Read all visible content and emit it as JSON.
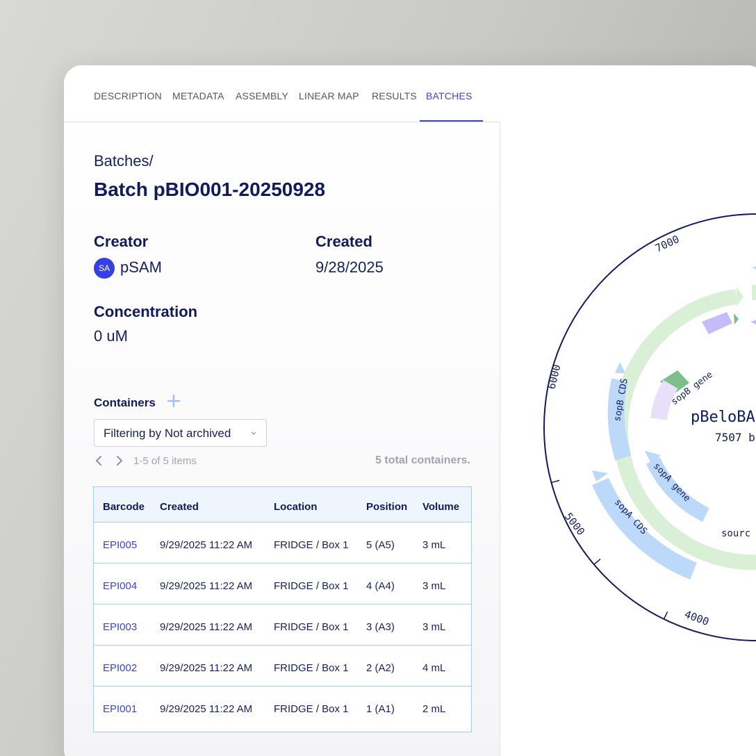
{
  "tabs": [
    {
      "label": "DESCRIPTION",
      "active": false
    },
    {
      "label": "METADATA",
      "active": false
    },
    {
      "label": "ASSEMBLY",
      "active": false
    },
    {
      "label": "LINEAR MAP",
      "active": false
    },
    {
      "label": "RESULTS",
      "active": false
    },
    {
      "label": "BATCHES",
      "active": true
    }
  ],
  "breadcrumb": "Batches/",
  "title": "Batch pBIO001-20250928",
  "creator": {
    "label": "Creator",
    "avatar_initials": "SA",
    "name": "pSAM"
  },
  "created": {
    "label": "Created",
    "value": "9/28/2025"
  },
  "concentration": {
    "label": "Concentration",
    "value": "0 uM"
  },
  "containers": {
    "label": "Containers",
    "filter": "Filtering by Not archived",
    "pager": "1-5 of 5 items",
    "total": "5 total containers.",
    "columns": [
      "Barcode",
      "Created",
      "Location",
      "Position",
      "Volume"
    ],
    "rows": [
      {
        "barcode": "EPI005",
        "created": "9/29/2025 11:22 AM",
        "location": "FRIDGE / Box 1",
        "position": "5 (A5)",
        "volume": "3 mL"
      },
      {
        "barcode": "EPI004",
        "created": "9/29/2025 11:22 AM",
        "location": "FRIDGE / Box 1",
        "position": "4 (A4)",
        "volume": "3 mL"
      },
      {
        "barcode": "EPI003",
        "created": "9/29/2025 11:22 AM",
        "location": "FRIDGE / Box 1",
        "position": "3 (A3)",
        "volume": "3 mL"
      },
      {
        "barcode": "EPI002",
        "created": "9/29/2025 11:22 AM",
        "location": "FRIDGE / Box 1",
        "position": "2 (A2)",
        "volume": "4 mL"
      },
      {
        "barcode": "EPI001",
        "created": "9/29/2025 11:22 AM",
        "location": "FRIDGE / Box 1",
        "position": "1 (A1)",
        "volume": "2 mL"
      }
    ]
  },
  "plasmid_map": {
    "name": "pBeloBA",
    "length": "7507 b",
    "ticks": [
      "7000",
      "6000",
      "5000",
      "4000"
    ],
    "features": [
      "sopB CDS",
      "sopB gene",
      "sopA gene",
      "sopA CDS",
      "sourc"
    ]
  },
  "colors": {
    "accent": "#3b43d8",
    "navy": "#111a5c",
    "cds_blue": "#bcd9fa",
    "source_green": "#d9efd6",
    "gene_green": "#7cbf8c",
    "gene_purple": "#c5bdfb"
  },
  "icons": [
    "plus-icon",
    "chevron-down-icon",
    "chevron-left-icon",
    "chevron-right-icon"
  ]
}
